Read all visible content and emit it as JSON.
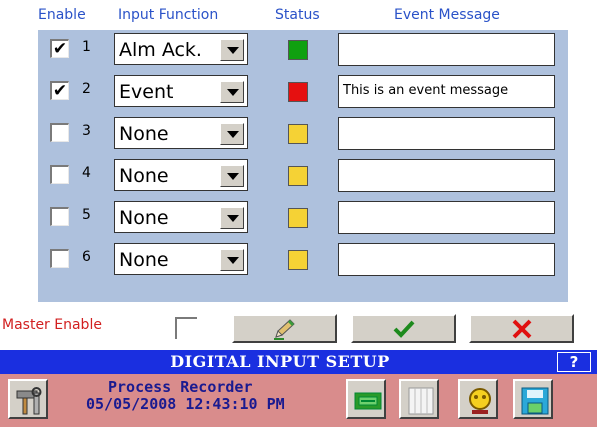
{
  "headers": {
    "enable": "Enable",
    "input_function": "Input Function",
    "status": "Status",
    "event_message": "Event Message"
  },
  "rows": [
    {
      "num": "1",
      "checked": true,
      "checkmark": "✔",
      "function": "Alm Ack.",
      "status_color": "#10a010",
      "message": ""
    },
    {
      "num": "2",
      "checked": true,
      "checkmark": "✔",
      "function": "Event",
      "status_color": "#e51010",
      "message": "This is an event message"
    },
    {
      "num": "3",
      "checked": false,
      "checkmark": "",
      "function": "None",
      "status_color": "#f5d235",
      "message": ""
    },
    {
      "num": "4",
      "checked": false,
      "checkmark": "",
      "function": "None",
      "status_color": "#f5d235",
      "message": ""
    },
    {
      "num": "5",
      "checked": false,
      "checkmark": "",
      "function": "None",
      "status_color": "#f5d235",
      "message": ""
    },
    {
      "num": "6",
      "checked": false,
      "checkmark": "",
      "function": "None",
      "status_color": "#f5d235",
      "message": ""
    }
  ],
  "master": {
    "label": "Master Enable",
    "checked": false
  },
  "buttons": {
    "edit": "pencil-icon",
    "ok": "checkmark-icon",
    "cancel": "x-icon"
  },
  "title": "DIGITAL INPUT SETUP",
  "help": "?",
  "footer": {
    "line1": "Process Recorder",
    "line2": "05/05/2008 12:43:10 PM"
  },
  "colors": {
    "header_text": "#2a52c8",
    "panel": "#aec1dd",
    "title_bar": "#1a2fe0",
    "footer_bg": "#d98c8c",
    "footer_text": "#1a1a90",
    "master_label": "#d22020"
  }
}
